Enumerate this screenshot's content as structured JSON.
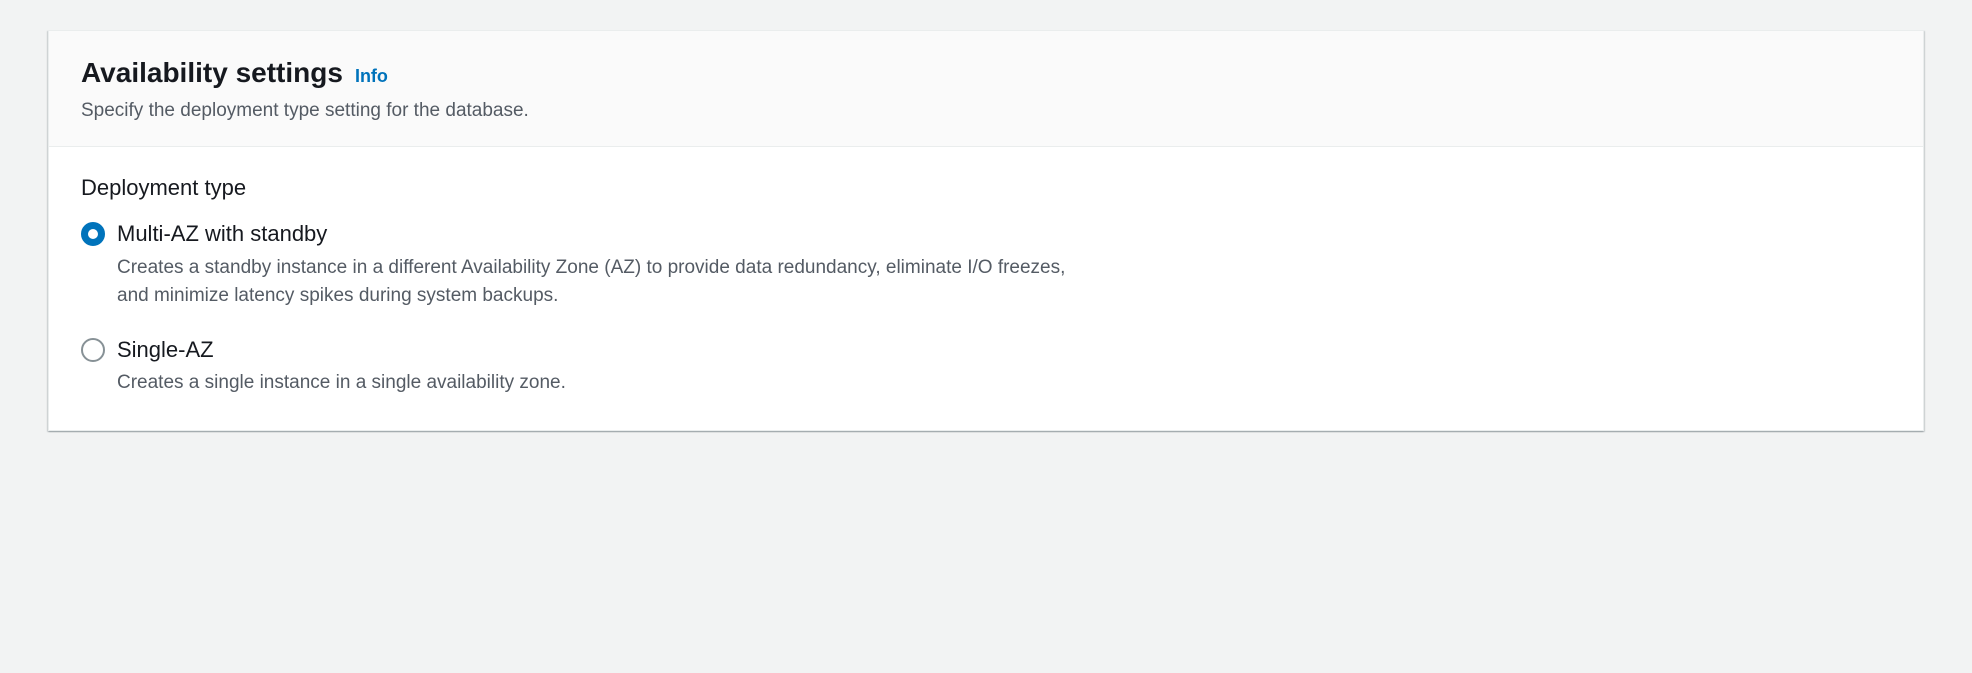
{
  "panel": {
    "title": "Availability settings",
    "info_label": "Info",
    "description": "Specify the deployment type setting for the database."
  },
  "deployment": {
    "label": "Deployment type",
    "options": [
      {
        "title": "Multi-AZ with standby",
        "description": "Creates a standby instance in a different Availability Zone (AZ) to provide data redundancy, eliminate I/O freezes, and minimize latency spikes during system backups.",
        "selected": true
      },
      {
        "title": "Single-AZ",
        "description": "Creates a single instance in a single availability zone.",
        "selected": false
      }
    ]
  }
}
